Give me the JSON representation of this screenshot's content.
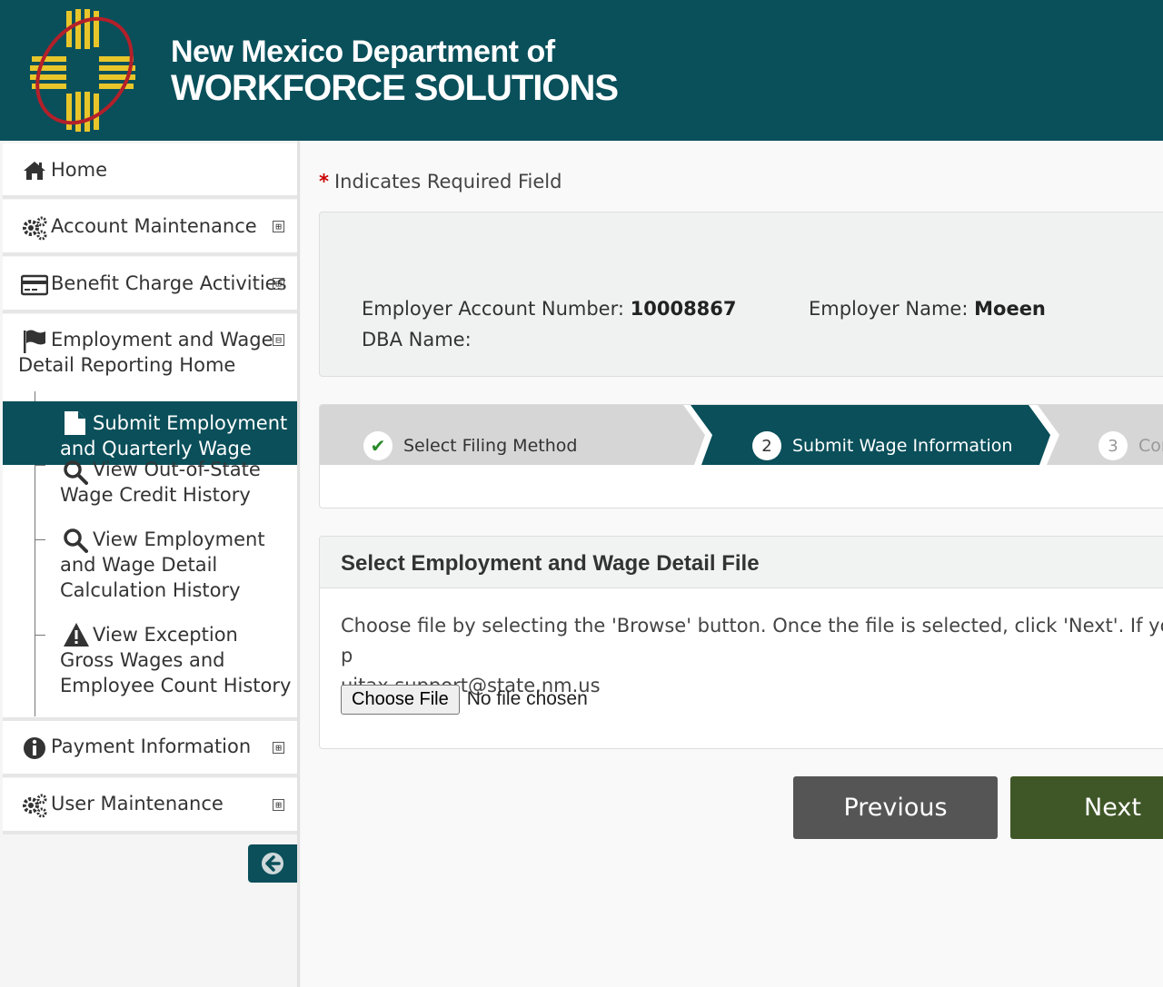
{
  "header": {
    "org_line1": "New Mexico Department of",
    "org_line2": "WORKFORCE SOLUTIONS",
    "colors": {
      "banner": "#09505b",
      "zia_yellow": "#e8c62a",
      "zia_ring": "#b3202a"
    }
  },
  "sidebar": {
    "items": [
      {
        "label": "Home",
        "icon": "home-icon"
      },
      {
        "label": "Account Maintenance",
        "icon": "gears-icon",
        "expander": "⊞"
      },
      {
        "label": "Benefit Charge Activities",
        "icon": "credit-card-icon",
        "expander": "⊞"
      },
      {
        "label_line1": "Employment and Wage",
        "label_line2": "Detail Reporting Home",
        "icon": "flag-icon",
        "expander": "⊟"
      },
      {
        "label": "Payment Information",
        "icon": "info-circle-icon",
        "expander": "⊞"
      },
      {
        "label": "User Maintenance",
        "icon": "gears-icon",
        "expander": "⊞"
      }
    ],
    "subitems": [
      {
        "label": "Submit Employment and Quarterly Wage",
        "icon": "document-icon",
        "active": true
      },
      {
        "label": "View Out-of-State Wage Credit History",
        "icon": "search-icon"
      },
      {
        "label": "View Employment and Wage Detail Calculation History",
        "icon": "search-icon"
      },
      {
        "label": "View Exception Gross Wages and Employee Count History",
        "icon": "warning-icon"
      }
    ],
    "collapse_icon": "arrow-left-circle-icon"
  },
  "main": {
    "required_star": "*",
    "required_note": "Indicates Required Field",
    "employer": {
      "account_label": "Employer Account Number:",
      "account_value": "10008867",
      "name_label": "Employer Name:",
      "name_value": "Moeen",
      "dba_label": "DBA Name:"
    },
    "wizard": {
      "steps": [
        {
          "marker": "✔",
          "label": "Select Filing Method",
          "state": "done"
        },
        {
          "marker": "2",
          "label": "Submit Wage Information",
          "state": "active"
        },
        {
          "marker": "3",
          "label": "Con",
          "state": "pending"
        }
      ]
    },
    "file_section": {
      "title": "Select Employment and Wage Detail File",
      "instructions_line1": "Choose file by selecting the 'Browse' button. Once the file is selected, click 'Next'. If you have p",
      "instructions_line2": "uitax.support@state.nm.us",
      "choose_file_label": "Choose File",
      "no_file_text": "No file chosen"
    },
    "buttons": {
      "previous": "Previous",
      "next": "Next"
    }
  }
}
